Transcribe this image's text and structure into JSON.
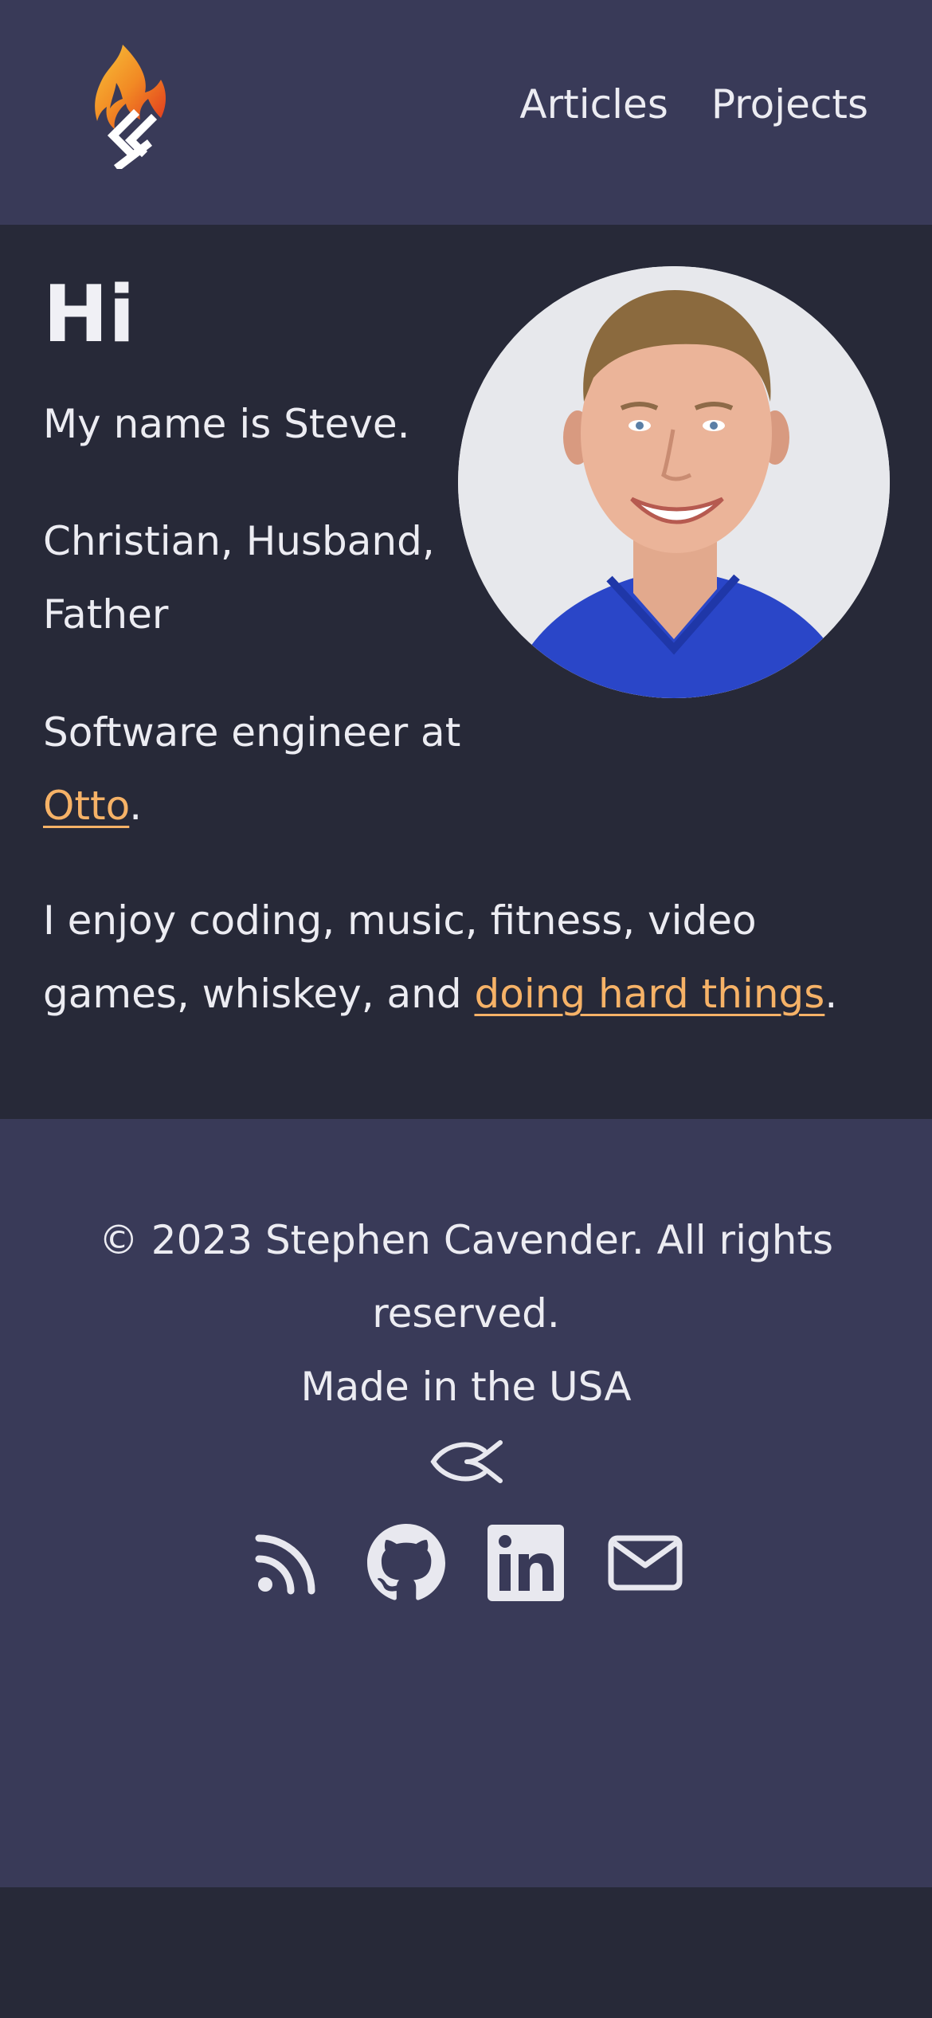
{
  "header": {
    "logo_icon": "flame-monogram-logo",
    "nav": [
      {
        "label": "Articles"
      },
      {
        "label": "Projects"
      }
    ]
  },
  "main": {
    "greeting": "Hi",
    "name_line": "My name is Steve.",
    "roles_line": "Christian, Husband, Father",
    "job_prefix": "Software engineer at ",
    "job_company": "Otto",
    "job_suffix": ".",
    "hobbies_prefix": "I enjoy coding, music, fitness, video games, whiskey, and ",
    "hobbies_link": "doing hard things",
    "hobbies_suffix": ".",
    "avatar_icon": "profile-photo"
  },
  "footer": {
    "copyright": "© 2023 Stephen Cavender. All rights reserved.",
    "made_in": "Made in the USA",
    "ichthys_icon": "ichthys-fish-icon",
    "social": [
      {
        "icon": "rss-icon"
      },
      {
        "icon": "github-icon"
      },
      {
        "icon": "linkedin-icon"
      },
      {
        "icon": "email-icon"
      }
    ]
  },
  "colors": {
    "header_bg": "#393a58",
    "main_bg": "#272938",
    "text": "#ececf2",
    "link": "#f6b267",
    "flame_orange": "#f5a623",
    "flame_red": "#e0341d"
  }
}
